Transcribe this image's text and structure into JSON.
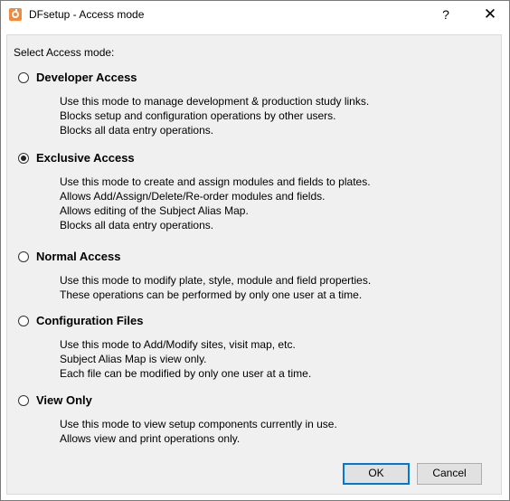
{
  "window": {
    "title": "DFsetup - Access mode",
    "help_glyph": "?",
    "close_glyph": "✕"
  },
  "group": {
    "title": "Select Access mode:"
  },
  "options": [
    {
      "label": "Developer Access",
      "selected": false,
      "lines": [
        "Use this mode to manage development & production study links.",
        "Blocks setup and configuration operations by other users.",
        "Blocks all data entry operations."
      ]
    },
    {
      "label": "Exclusive Access",
      "selected": true,
      "lines": [
        "Use this mode to create and assign modules and fields to plates.",
        "Allows Add/Assign/Delete/Re-order modules and fields.",
        "Allows editing of the Subject Alias Map.",
        "Blocks all data entry operations."
      ]
    },
    {
      "label": "Normal Access",
      "selected": false,
      "lines": [
        "Use this mode to modify plate, style, module and field properties.",
        "These operations can be performed by only one user at a time."
      ]
    },
    {
      "label": "Configuration Files",
      "selected": false,
      "lines": [
        "Use this mode to Add/Modify sites, visit map, etc.",
        "Subject Alias Map is view only.",
        "Each file can be modified by only one user at a time."
      ]
    },
    {
      "label": "View Only",
      "selected": false,
      "lines": [
        "Use this mode to view setup components currently in use.",
        "Allows view and print operations only."
      ]
    }
  ],
  "buttons": {
    "ok": "OK",
    "cancel": "Cancel"
  }
}
